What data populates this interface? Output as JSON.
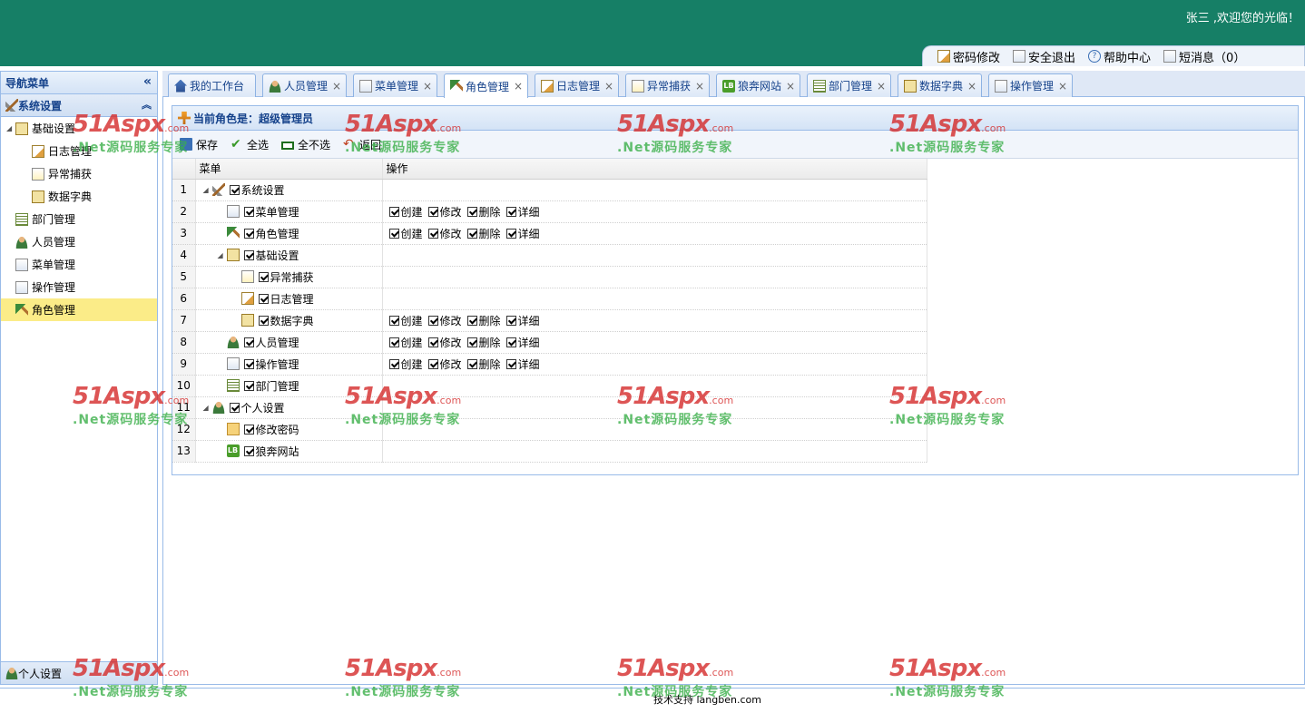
{
  "header": {
    "welcome": "张三 ,欢迎您的光临！",
    "links": [
      {
        "label": "密码修改",
        "icon": "edit-password-icon"
      },
      {
        "label": "安全退出",
        "icon": "logout-icon"
      },
      {
        "label": "帮助中心",
        "icon": "help-icon"
      },
      {
        "label": "短消息（0）",
        "icon": "message-icon"
      }
    ]
  },
  "sidebar": {
    "title": "导航菜单",
    "section": "系统设置",
    "tree": [
      {
        "label": "基础设置",
        "level": 0,
        "icon": "base-settings-icon"
      },
      {
        "label": "日志管理",
        "level": 1,
        "icon": "log-icon"
      },
      {
        "label": "异常捕获",
        "level": 1,
        "icon": "exception-icon"
      },
      {
        "label": "数据字典",
        "level": 1,
        "icon": "dictionary-icon"
      },
      {
        "label": "部门管理",
        "level": 0,
        "icon": "department-icon"
      },
      {
        "label": "人员管理",
        "level": 0,
        "icon": "user-icon"
      },
      {
        "label": "菜单管理",
        "level": 0,
        "icon": "menu-icon"
      },
      {
        "label": "操作管理",
        "level": 0,
        "icon": "operation-icon"
      },
      {
        "label": "角色管理",
        "level": 0,
        "icon": "role-icon",
        "selected": true
      }
    ],
    "bottom_section": "个人设置"
  },
  "tabs": [
    {
      "label": "我的工作台",
      "icon": "home-icon",
      "closable": false
    },
    {
      "label": "人员管理",
      "icon": "user-icon",
      "closable": true
    },
    {
      "label": "菜单管理",
      "icon": "menu-icon",
      "closable": true
    },
    {
      "label": "角色管理",
      "icon": "role-icon",
      "closable": true,
      "active": true
    },
    {
      "label": "日志管理",
      "icon": "log-icon",
      "closable": true
    },
    {
      "label": "异常捕获",
      "icon": "exception-icon",
      "closable": true
    },
    {
      "label": "狼奔网站",
      "icon": "lb-icon",
      "closable": true
    },
    {
      "label": "部门管理",
      "icon": "department-icon",
      "closable": true
    },
    {
      "label": "数据字典",
      "icon": "dictionary-icon",
      "closable": true
    },
    {
      "label": "操作管理",
      "icon": "operation-icon",
      "closable": true
    }
  ],
  "main": {
    "role_title": "当前角色是：超级管理员",
    "toolbar": {
      "save": "保存",
      "select_all": "全选",
      "select_none": "全不选",
      "back": "返回"
    },
    "columns": {
      "menu": "菜单",
      "operation": "操作"
    },
    "rows": [
      {
        "n": "1",
        "label": "系统设置",
        "level": 0,
        "expander": true,
        "icon": "settings-icon",
        "ops": []
      },
      {
        "n": "2",
        "label": "菜单管理",
        "level": 1,
        "icon": "menu-icon",
        "ops": [
          "创建",
          "修改",
          "删除",
          "详细"
        ]
      },
      {
        "n": "3",
        "label": "角色管理",
        "level": 1,
        "icon": "role-icon",
        "ops": [
          "创建",
          "修改",
          "删除",
          "详细"
        ]
      },
      {
        "n": "4",
        "label": "基础设置",
        "level": 1,
        "expander": true,
        "icon": "base-settings-icon",
        "ops": []
      },
      {
        "n": "5",
        "label": "异常捕获",
        "level": 2,
        "icon": "exception-icon",
        "ops": []
      },
      {
        "n": "6",
        "label": "日志管理",
        "level": 2,
        "icon": "log-icon",
        "ops": []
      },
      {
        "n": "7",
        "label": "数据字典",
        "level": 2,
        "icon": "dictionary-icon",
        "ops": [
          "创建",
          "修改",
          "删除",
          "详细"
        ]
      },
      {
        "n": "8",
        "label": "人员管理",
        "level": 1,
        "icon": "user-icon",
        "ops": [
          "创建",
          "修改",
          "删除",
          "详细"
        ]
      },
      {
        "n": "9",
        "label": "操作管理",
        "level": 1,
        "icon": "operation-icon",
        "ops": [
          "创建",
          "修改",
          "删除",
          "详细"
        ]
      },
      {
        "n": "10",
        "label": "部门管理",
        "level": 1,
        "icon": "department-icon",
        "ops": []
      },
      {
        "n": "11",
        "label": "个人设置",
        "level": 0,
        "expander": true,
        "icon": "user-icon",
        "ops": []
      },
      {
        "n": "12",
        "label": "修改密码",
        "level": 1,
        "icon": "mail-icon",
        "ops": []
      },
      {
        "n": "13",
        "label": "狼奔网站",
        "level": 1,
        "icon": "lb-icon",
        "ops": []
      }
    ]
  },
  "footer": {
    "text": "技术支持 langben.com"
  },
  "watermark": {
    "brand": "51Aspx",
    "suffix": ".com",
    "slogan": ".Net源码服务专家"
  },
  "colors": {
    "header": "#167f66",
    "accent": "#15428b",
    "selected": "#fbec88"
  }
}
